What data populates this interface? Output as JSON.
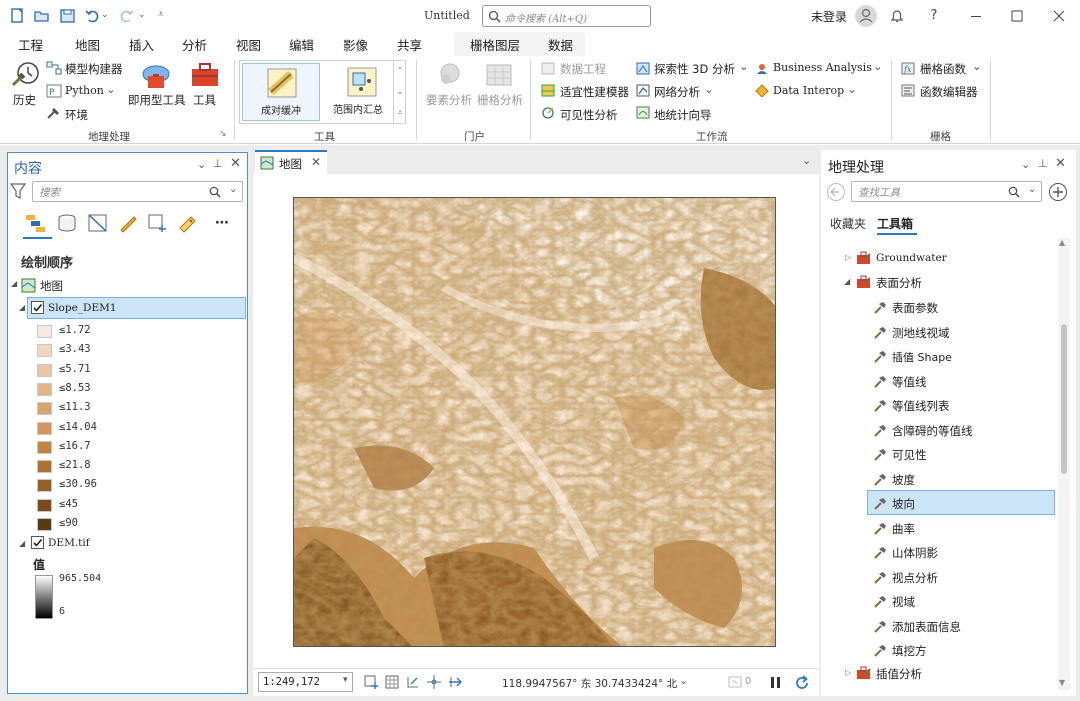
{
  "title_bar": {
    "doc_title": "Untitled",
    "search_placeholder": "命令搜索 (Alt+Q)",
    "login": "未登录",
    "help": "?"
  },
  "ribbon_tabs": [
    "工程",
    "地图",
    "插入",
    "分析",
    "视图",
    "编辑",
    "影像",
    "共享"
  ],
  "active_tab": "分析",
  "context_tabs": [
    "栅格图层",
    "数据"
  ],
  "ribbon": {
    "geoprocessing": {
      "history": "历史",
      "model_builder": "模型构建器",
      "python": "Python",
      "environments": "环境",
      "ready_tools": "即用型工具",
      "tools": "工具",
      "label": "地理处理"
    },
    "tools_gallery": {
      "item1": "成对缓冲",
      "item2": "范围内汇总",
      "label": "工具"
    },
    "portal": {
      "feature_analysis": "要素分析",
      "raster_analysis": "栅格分析",
      "label": "门户"
    },
    "workflows": {
      "data_engineering": "数据工程",
      "suitability_modeler": "适宜性建模器",
      "visibility_analysis": "可见性分析",
      "exploratory_3d": "探索性 3D 分析",
      "network_analysis": "网络分析",
      "geostatistical_wizard": "地统计向导",
      "business_analysis": "Business Analysis",
      "data_interop": "Data Interop",
      "label": "工作流"
    },
    "raster": {
      "raster_functions": "栅格函数",
      "function_editor": "函数编辑器",
      "label": "栅格"
    }
  },
  "contents_pane": {
    "title": "内容",
    "search_placeholder": "搜索",
    "drawing_order": "绘制顺序",
    "map_name": "地图",
    "layer1": {
      "name": "Slope_DEM1",
      "checked": true,
      "classes": [
        {
          "label": "≤1.72",
          "color": "#f6e9df"
        },
        {
          "label": "≤3.43",
          "color": "#f0d8c3"
        },
        {
          "label": "≤5.71",
          "color": "#eac6a4"
        },
        {
          "label": "≤8.53",
          "color": "#e3b486"
        },
        {
          "label": "≤11.3",
          "color": "#dba46c"
        },
        {
          "label": "≤14.04",
          "color": "#d3955a"
        },
        {
          "label": "≤16.7",
          "color": "#c4843f"
        },
        {
          "label": "≤21.8",
          "color": "#ae722e"
        },
        {
          "label": "≤30.96",
          "color": "#946026"
        },
        {
          "label": "≤45",
          "color": "#7a4d1d"
        },
        {
          "label": "≤90",
          "color": "#5a3913"
        }
      ]
    },
    "layer2": {
      "name": "DEM.tif",
      "checked": true,
      "value_label": "值",
      "max": "965.504",
      "min": "6"
    }
  },
  "map_view": {
    "tab": "地图",
    "scale": "1:249,172",
    "coords": "118.9947567° 东 30.7433424° 北",
    "selected_count": "0"
  },
  "geoprocessing_pane": {
    "title": "地理处理",
    "search_placeholder": "查找工具",
    "tabs": [
      "收藏夹",
      "工具箱"
    ],
    "active_tab": "工具箱",
    "toolsets": [
      "Groundwater",
      "表面分析",
      "插值分析"
    ],
    "tools": [
      "表面参数",
      "测地线视域",
      "插值 Shape",
      "等值线",
      "等值线列表",
      "含障碍的等值线",
      "可见性",
      "坡度",
      "坡向",
      "曲率",
      "山体阴影",
      "视点分析",
      "视域",
      "添加表面信息",
      "填挖方"
    ],
    "selected_tool": "坡向"
  },
  "colors": {
    "accent": "#2a7ac0",
    "selection": "#cce4f7",
    "slope_dark": "#5a3913",
    "slope_light": "#fbf1e6"
  }
}
